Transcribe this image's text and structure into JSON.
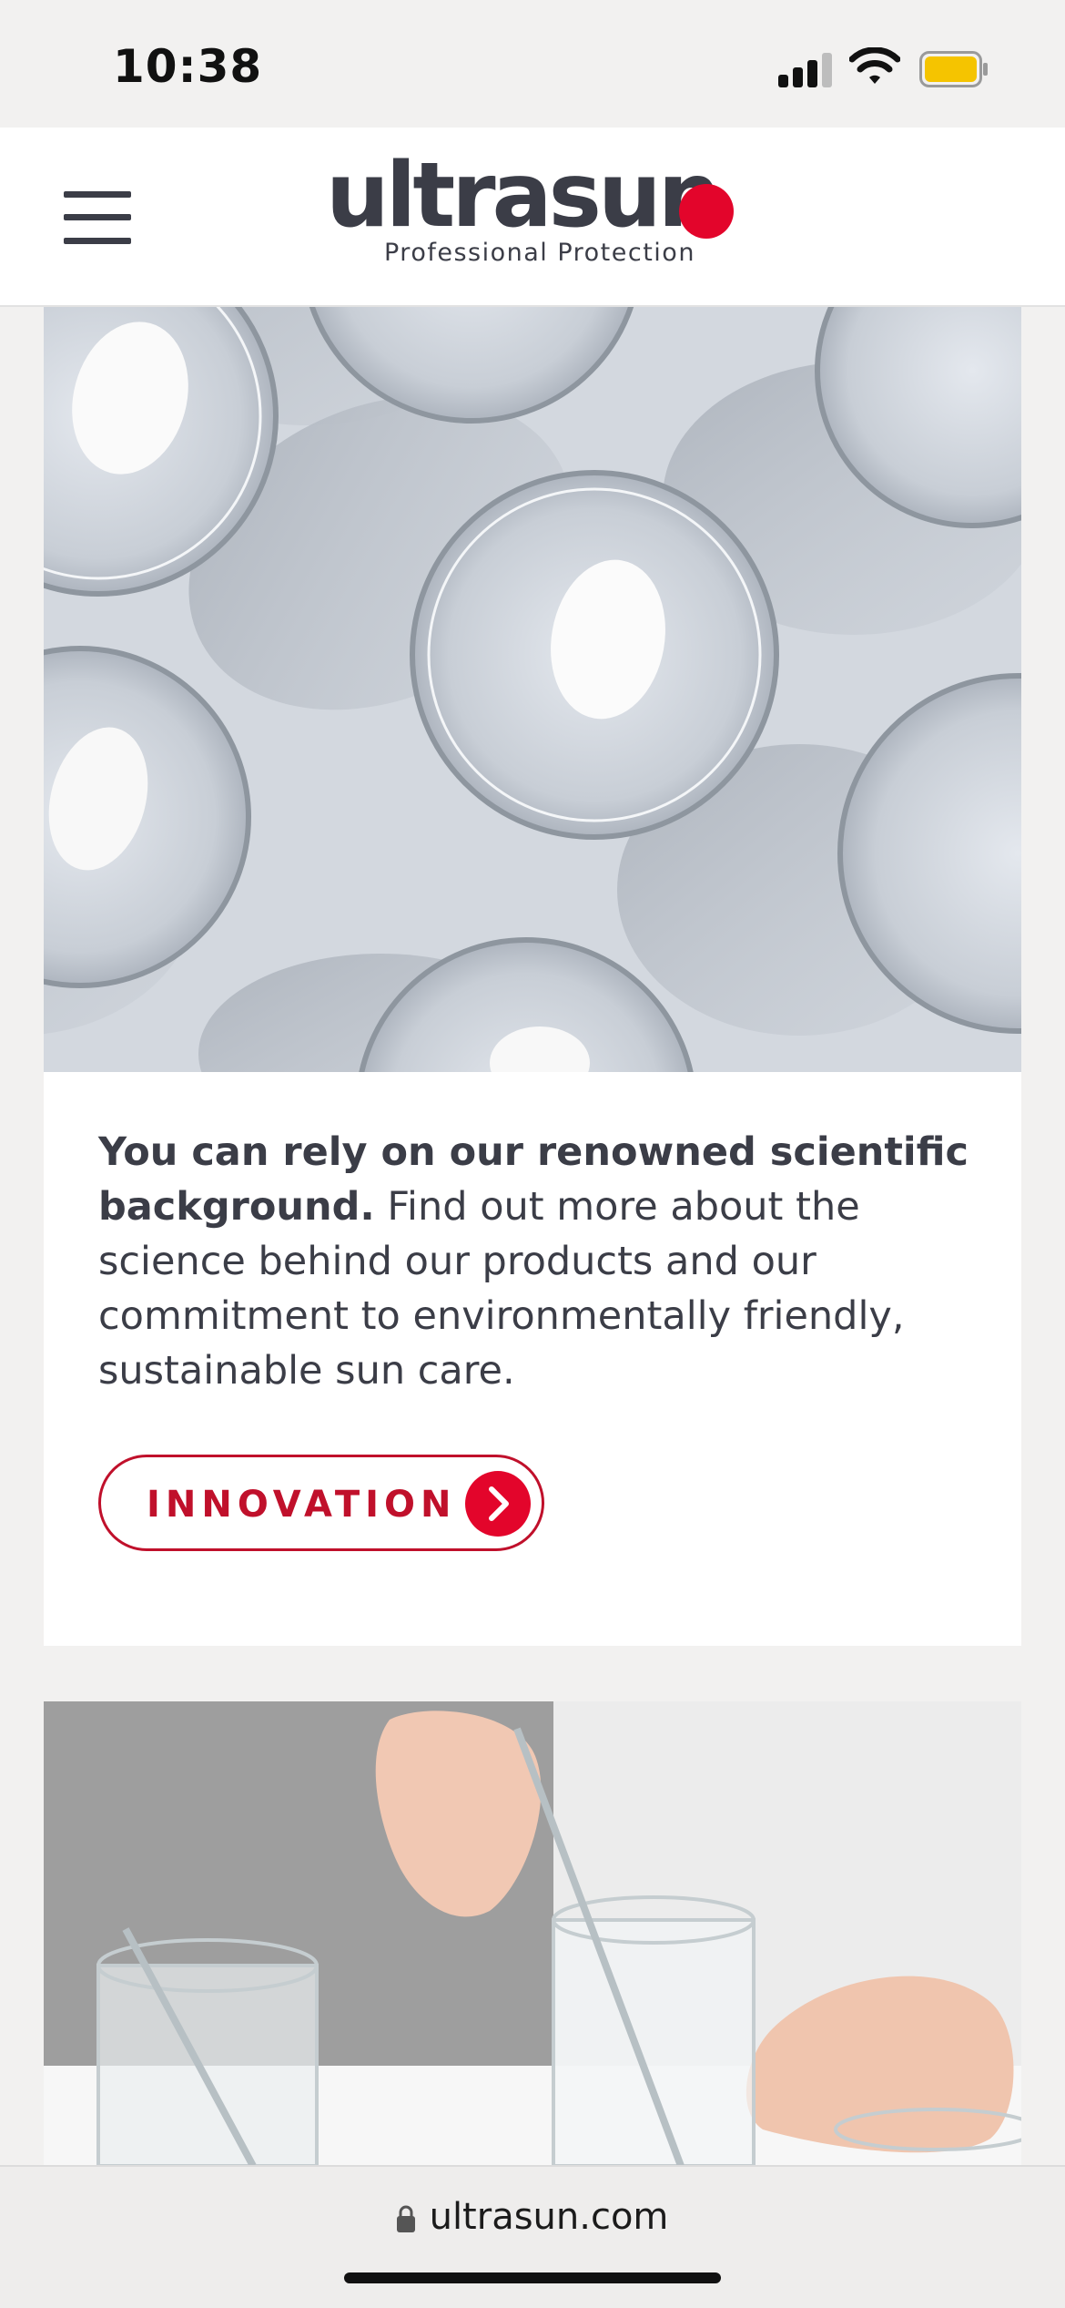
{
  "status_bar": {
    "time": "10:38",
    "icons": [
      "cellular-signal-icon",
      "wifi-icon",
      "battery-icon"
    ],
    "battery_color": "#f5c400"
  },
  "header": {
    "menu_icon": "hamburger-menu-icon",
    "logo": {
      "word": "ultrasun",
      "tagline": "Professional Protection"
    }
  },
  "colors": {
    "brand_red": "#e3052b",
    "cta_red": "#c0102b",
    "text_dark": "#3b3d47",
    "background": "#f2f1f0"
  },
  "card1": {
    "image_icon": "petri-dishes-with-cream-photo",
    "text_bold": "You can rely on our renowned scientific background.",
    "text_rest": " Find out more about the science behind our products and our commitment to environmentally friendly, sustainable sun care.",
    "cta_label": "INNOVATION",
    "cta_icon": "chevron-right-icon"
  },
  "card2": {
    "image_icon": "lab-beakers-stirring-photo"
  },
  "browser": {
    "url": "ultrasun.com",
    "lock_icon": "lock-icon"
  }
}
